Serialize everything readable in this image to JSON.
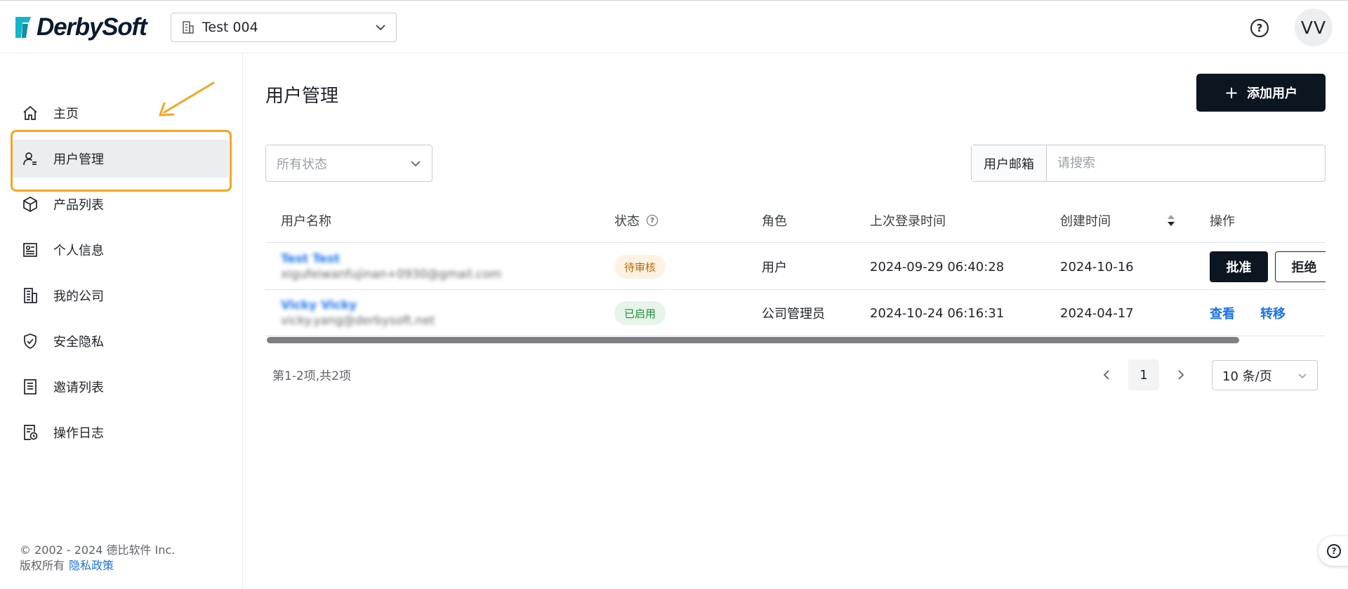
{
  "header": {
    "logo_text": "DerbySoft",
    "company_select": {
      "value": "Test 004"
    },
    "help_glyph": "?",
    "avatar_initials": "VV"
  },
  "sidebar": {
    "items": [
      {
        "label": "主页",
        "icon": "home-icon"
      },
      {
        "label": "用户管理",
        "icon": "user-manage-icon",
        "active": true
      },
      {
        "label": "产品列表",
        "icon": "box-icon"
      },
      {
        "label": "个人信息",
        "icon": "profile-card-icon"
      },
      {
        "label": "我的公司",
        "icon": "building-icon"
      },
      {
        "label": "安全隐私",
        "icon": "shield-check-icon"
      },
      {
        "label": "邀请列表",
        "icon": "document-list-icon"
      },
      {
        "label": "操作日志",
        "icon": "log-clock-icon"
      }
    ],
    "footer": {
      "copyright": "© 2002 - 2024 德比软件 Inc.",
      "rights": "版权所有",
      "privacy_link": "隐私政策"
    }
  },
  "main": {
    "title": "用户管理",
    "add_button": {
      "plus": "+",
      "label": "添加用户"
    },
    "status_filter": {
      "placeholder": "所有状态"
    },
    "search": {
      "addon_label": "用户邮箱",
      "placeholder": "请搜索"
    },
    "table": {
      "columns": {
        "name": "用户名称",
        "status": "状态",
        "role": "角色",
        "last_login": "上次登录时间",
        "created": "创建时间",
        "actions": "操作"
      },
      "rows": [
        {
          "name": "Test Test",
          "email": "xigufeiwanfujinan+0930@gmail.com",
          "status": "待审核",
          "status_type": "pending",
          "role": "用户",
          "last_login": "2024-09-29 06:40:28",
          "created": "2024-10-16",
          "actions": [
            "批准",
            "拒绝"
          ]
        },
        {
          "name": "Vicky Vicky",
          "email": "vicky.yang@derbysoft.net",
          "status": "已启用",
          "status_type": "enabled",
          "role": "公司管理员",
          "last_login": "2024-10-24 06:16:31",
          "created": "2024-04-17",
          "actions": [
            "查看",
            "转移"
          ]
        }
      ]
    },
    "pagination": {
      "total_text": "第1-2项,共2项",
      "current_page": "1",
      "page_size": "10 条/页"
    }
  },
  "colors": {
    "accent": "#1a73e8",
    "primary_dark": "#0b1620",
    "highlight": "#f5a623",
    "pending": "#b86a0a",
    "enabled": "#1e8e3e"
  }
}
